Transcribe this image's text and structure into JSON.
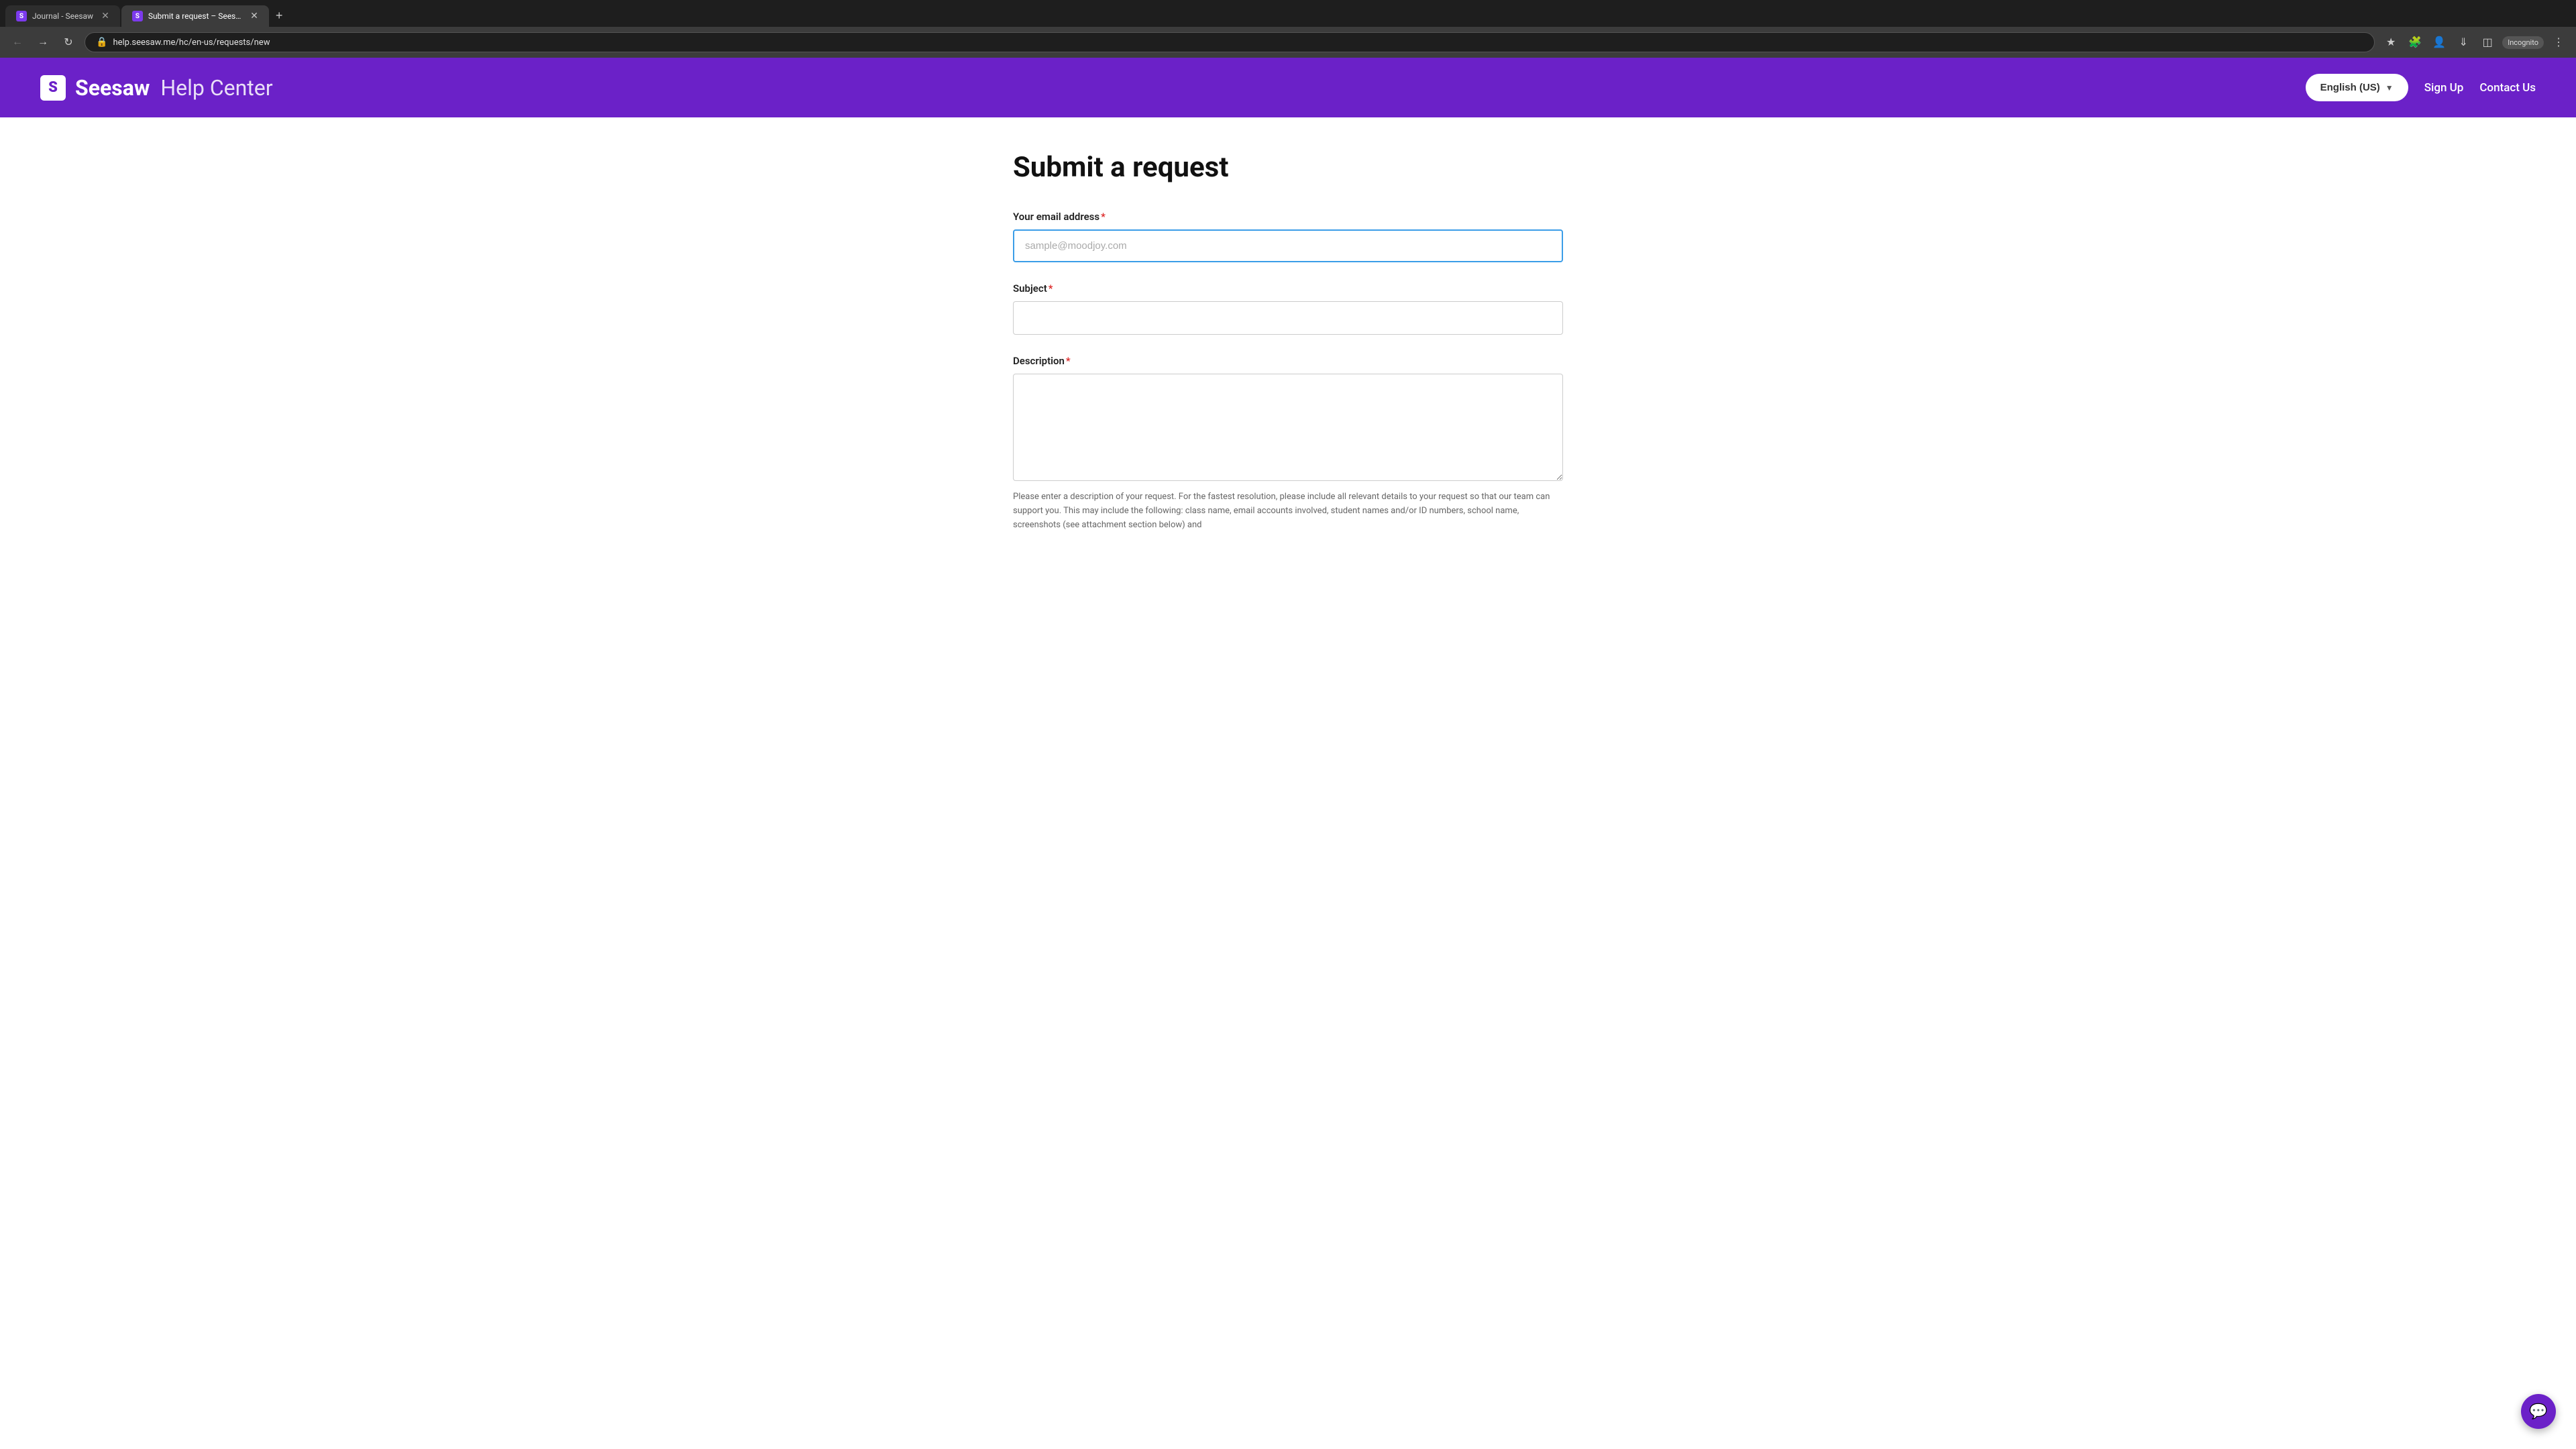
{
  "browser": {
    "tabs": [
      {
        "id": "tab1",
        "title": "Journal - Seesaw",
        "favicon": "S",
        "active": false
      },
      {
        "id": "tab2",
        "title": "Submit a request – Seesaw Hel...",
        "favicon": "S",
        "active": true
      }
    ],
    "new_tab_label": "+",
    "url": "help.seesaw.me/hc/en-us/requests/new",
    "incognito_label": "Incognito"
  },
  "header": {
    "logo_s": "S",
    "logo_seesaw": "Seesaw",
    "logo_help": "Help Center",
    "language_btn": "English (US)",
    "sign_up": "Sign Up",
    "contact_us": "Contact Us"
  },
  "form": {
    "page_title": "Submit a request",
    "email_label": "Your email address",
    "email_placeholder": "sample@moodjoy.com",
    "subject_label": "Subject",
    "description_label": "Description",
    "description_hint": "Please enter a description of your request. For the fastest resolution, please include all relevant details to your request so that our team can support you. This may include the following: class name, email accounts involved, student names and/or ID numbers, school name, screenshots (see attachment section below) and"
  },
  "chat": {
    "icon": "💬"
  }
}
